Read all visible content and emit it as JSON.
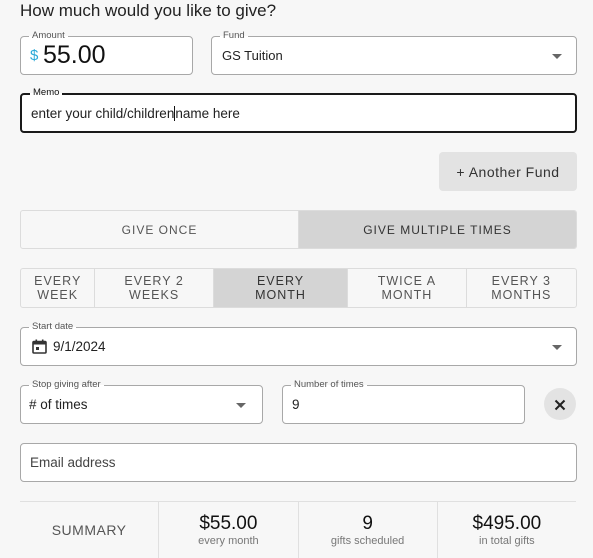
{
  "heading": "How much would you like to give?",
  "amount": {
    "label": "Amount",
    "currency": "$",
    "value": "55.00"
  },
  "fund": {
    "label": "Fund",
    "value": "GS Tuition"
  },
  "memo": {
    "label": "Memo",
    "value_before_cursor": "enter your child/children",
    "value_after_cursor": "name here"
  },
  "another_fund_label": "+ Another Fund",
  "give_mode": {
    "options": [
      "GIVE ONCE",
      "GIVE MULTIPLE TIMES"
    ],
    "selected": "GIVE MULTIPLE TIMES"
  },
  "frequency": {
    "options": [
      "EVERY WEEK",
      "EVERY 2 WEEKS",
      "EVERY MONTH",
      "TWICE A MONTH",
      "EVERY 3 MONTHS"
    ],
    "selected": "EVERY MONTH"
  },
  "start_date": {
    "label": "Start date",
    "value": "9/1/2024",
    "icon": "calendar-icon"
  },
  "stop_after": {
    "label": "Stop giving after",
    "value": "# of times"
  },
  "number_of_times": {
    "label": "Number of times",
    "value": "9"
  },
  "email": {
    "placeholder": "Email address"
  },
  "summary": {
    "title": "SUMMARY",
    "per_gift": {
      "value": "$55.00",
      "caption": "every month"
    },
    "count": {
      "value": "9",
      "caption": "gifts scheduled"
    },
    "total": {
      "value": "$495.00",
      "caption": "in total gifts"
    }
  },
  "colors": {
    "currency_accent": "#2aa9d8",
    "selected_segment": "#d4d4d4",
    "background": "#f7f7f7"
  }
}
